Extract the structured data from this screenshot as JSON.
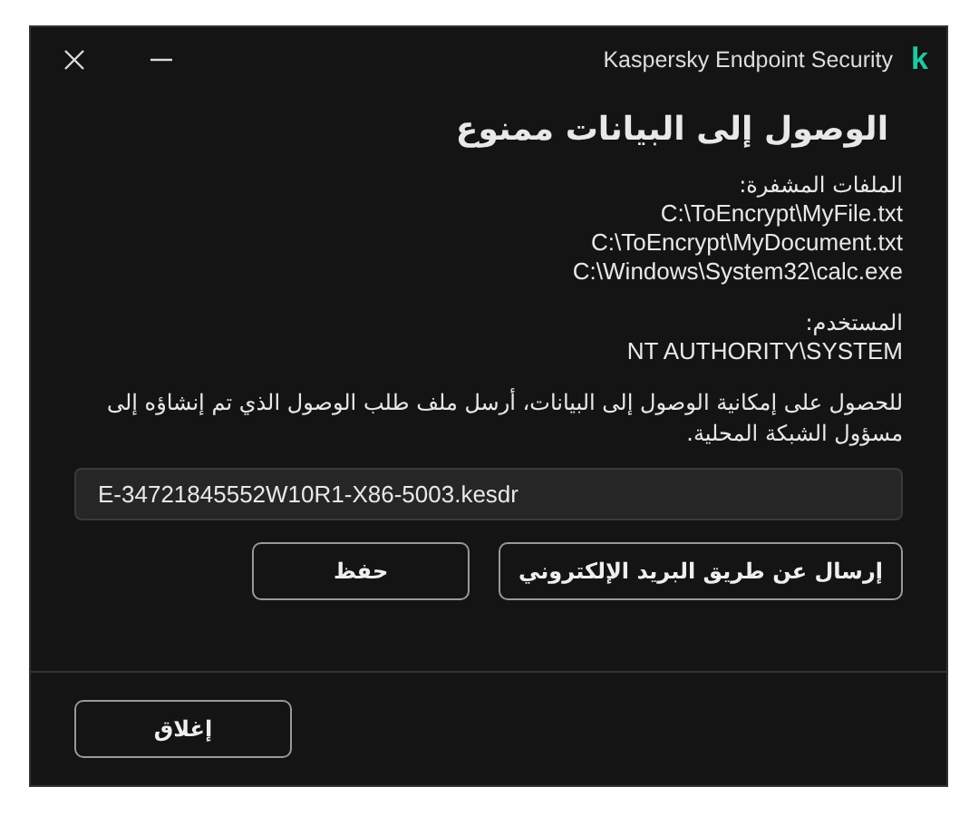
{
  "window": {
    "title": "Kaspersky Endpoint Security",
    "logo": "k"
  },
  "heading": "الوصول إلى البيانات ممنوع",
  "files": {
    "label": "الملفات المشفرة:",
    "paths": [
      "C:\\ToEncrypt\\MyFile.txt",
      "C:\\ToEncrypt\\MyDocument.txt",
      "C:\\Windows\\System32\\calc.exe"
    ]
  },
  "user": {
    "label": "المستخدم:",
    "value": "NT AUTHORITY\\SYSTEM"
  },
  "message": "للحصول على إمكانية الوصول إلى البيانات، أرسل ملف طلب الوصول الذي تم إنشاؤه إلى مسؤول الشبكة المحلية.",
  "file_field": {
    "value": "E-34721845552W10R1-X86-5003.kesdr"
  },
  "buttons": [
    "إرسال عن طريق البريد الإلكتروني",
    "حفظ"
  ],
  "footer_button": "إغلاق"
}
